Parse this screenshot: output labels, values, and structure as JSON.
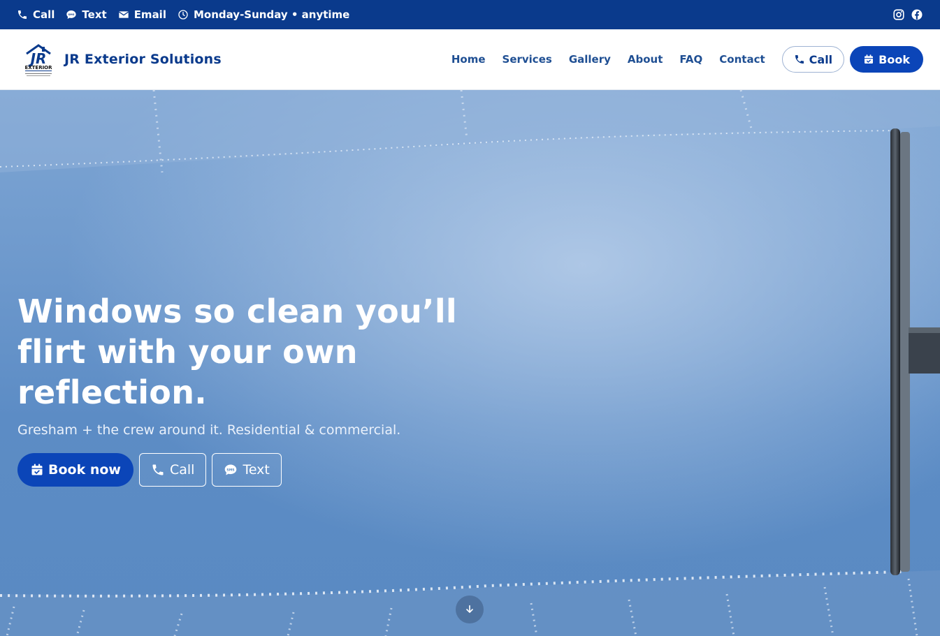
{
  "topbar": {
    "call_label": "Call",
    "text_label": "Text",
    "email_label": "Email",
    "hours_label": "Monday-Sunday • anytime"
  },
  "header": {
    "brand_name": "JR Exterior Solutions",
    "nav": [
      {
        "label": "Home"
      },
      {
        "label": "Services"
      },
      {
        "label": "Gallery"
      },
      {
        "label": "About"
      },
      {
        "label": "FAQ"
      },
      {
        "label": "Contact"
      }
    ],
    "call_label": "Call",
    "book_label": "Book"
  },
  "hero": {
    "title": "Windows so clean you’ll flirt with your own reflection.",
    "subtitle": "Gresham + the crew around it. Residential & commercial.",
    "book_label": "Book now",
    "call_label": "Call",
    "text_label": "Text"
  },
  "icons": {
    "phone": "phone-icon",
    "sms": "sms-icon",
    "email": "envelope-icon",
    "clock": "clock-icon",
    "instagram": "instagram-icon",
    "facebook": "facebook-icon",
    "calendar": "calendar-check-icon",
    "arrow_down": "arrow-down-icon"
  },
  "colors": {
    "brand_navy": "#0a3a8c",
    "brand_blue": "#0b45b8",
    "nav_text": "#1f4f93"
  }
}
